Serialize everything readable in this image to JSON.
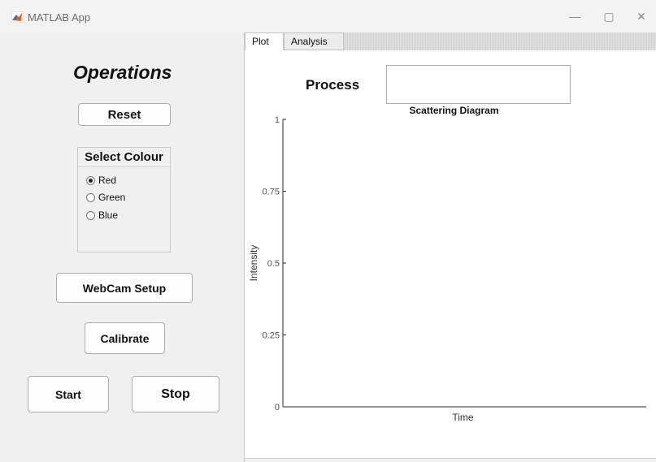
{
  "window": {
    "title": "MATLAB App",
    "controls": {
      "minimize": "—",
      "maximize": "▢",
      "close": "✕"
    }
  },
  "left_panel": {
    "title": "Operations",
    "reset_label": "Reset",
    "colour_group": {
      "title": "Select Colour",
      "options": [
        "Red",
        "Green",
        "Blue"
      ],
      "selected": "Red"
    },
    "webcam_label": "WebCam Setup",
    "calibrate_label": "Calibrate",
    "start_label": "Start",
    "stop_label": "Stop"
  },
  "tabs": [
    {
      "label": "Plot",
      "active": true
    },
    {
      "label": "Analysis",
      "active": false
    }
  ],
  "plot_tab": {
    "process_label": "Process",
    "process_value": ""
  },
  "chart_data": {
    "type": "scatter",
    "title": "Scattering Diagram",
    "xlabel": "Time",
    "ylabel": "Intensity",
    "ylim": [
      0,
      1
    ],
    "yticks": [
      0,
      0.25,
      0.5,
      0.75,
      1
    ],
    "ytick_labels": [
      "0",
      "0.25",
      "0.5",
      "0.75",
      "1"
    ],
    "xticks": [],
    "series": [],
    "grid": false
  }
}
